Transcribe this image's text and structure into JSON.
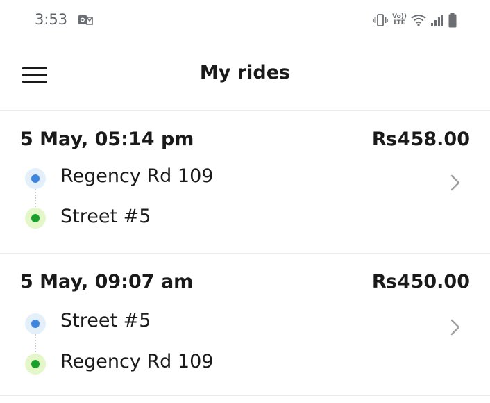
{
  "status_bar": {
    "time": "3:53",
    "notification_icon": "outlook-mail-icon",
    "right_icons": [
      "vibrate-icon",
      "volte-icon",
      "wifi-icon",
      "signal-icon",
      "battery-icon"
    ],
    "volte_line1": "Vo))",
    "volte_line2": "LTE"
  },
  "header": {
    "title": "My rides",
    "menu_icon": "hamburger-menu-icon"
  },
  "rides": [
    {
      "datetime": "5 May, 05:14 pm",
      "currency": "Rs",
      "amount": "458.00",
      "pickup": "Regency Rd 109",
      "dropoff": "Street #5"
    },
    {
      "datetime": "5 May, 09:07 am",
      "currency": "Rs",
      "amount": "450.00",
      "pickup": "Street #5",
      "dropoff": "Regency Rd 109"
    }
  ],
  "colors": {
    "pickup_dot": "#3d86e0",
    "pickup_halo": "#e3f0fb",
    "dropoff_dot": "#18a02b",
    "dropoff_halo": "#e3f7c8",
    "text": "#1a1a1a",
    "divider": "#ececec"
  }
}
